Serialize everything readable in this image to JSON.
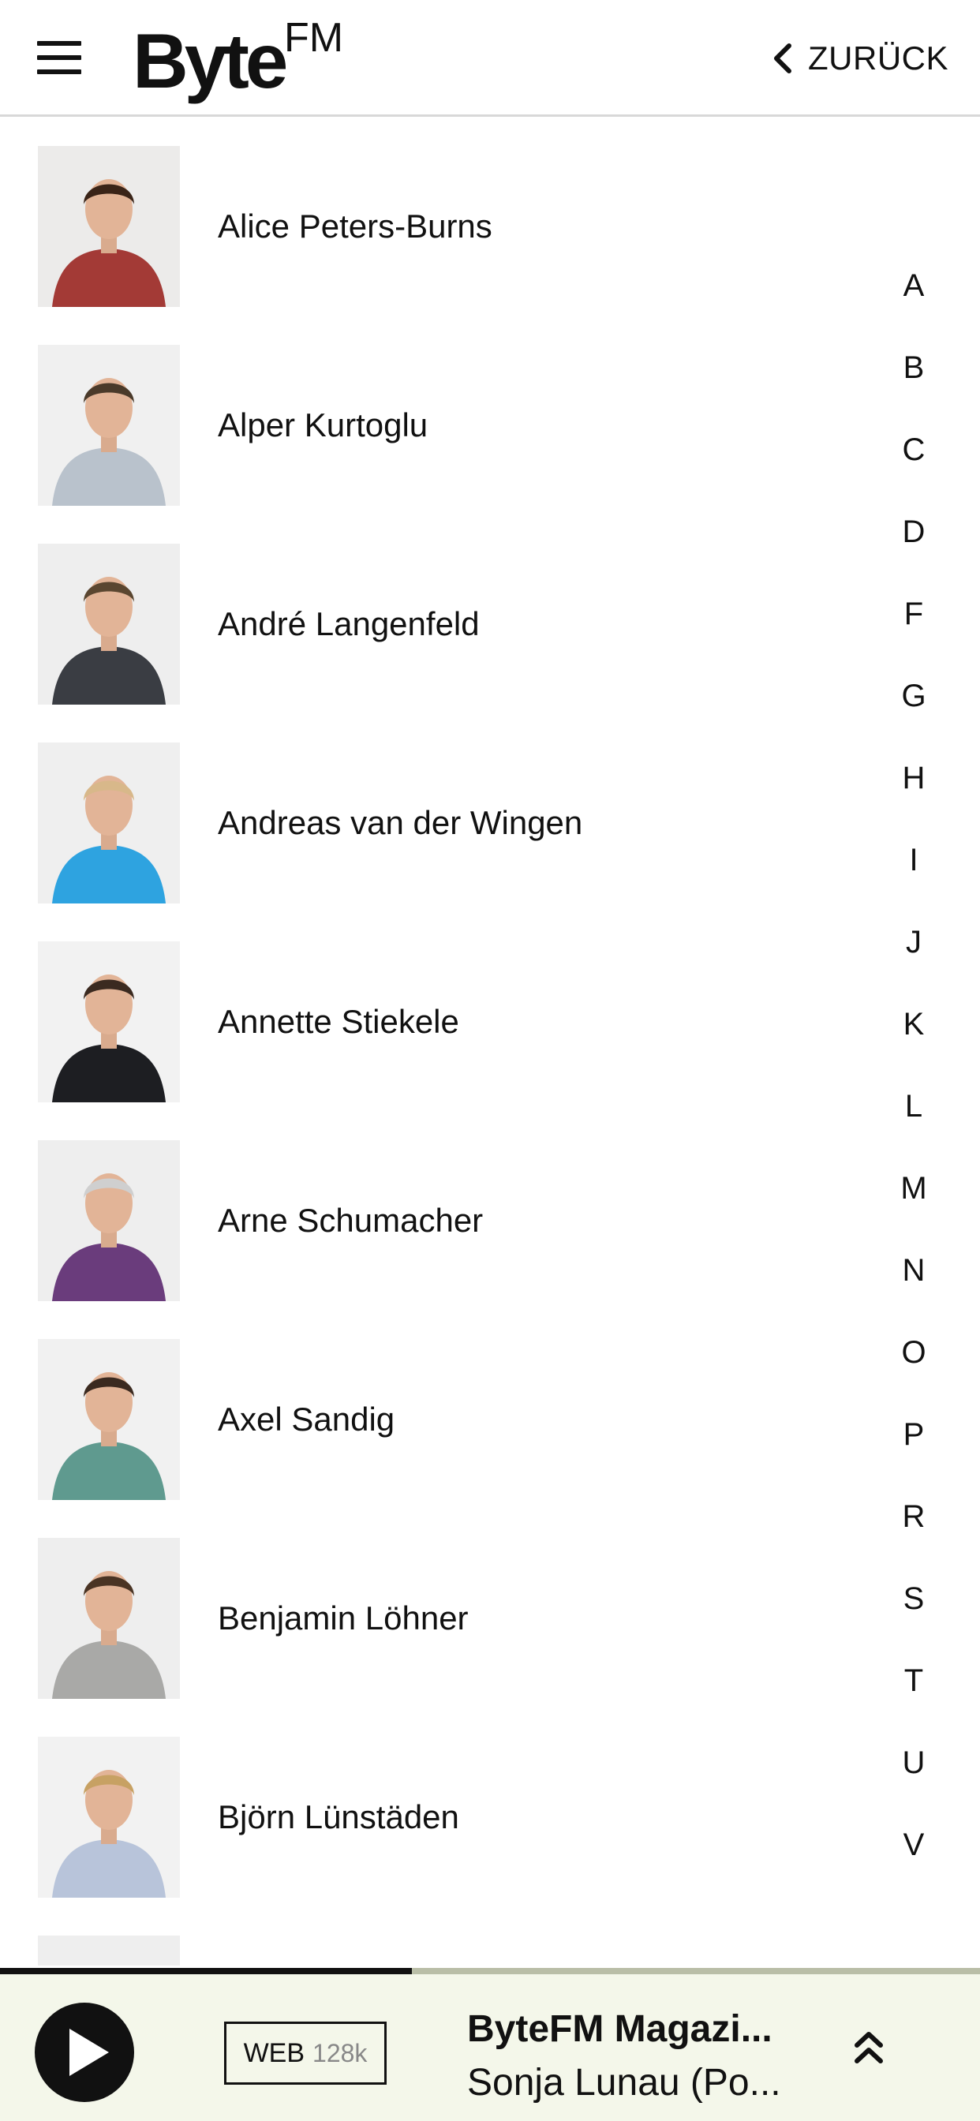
{
  "header": {
    "logo_main": "Byte",
    "logo_sup": "FM",
    "back_label": "ZURÜCK"
  },
  "people": [
    {
      "name": "Alice Peters-Burns",
      "shirt": "#a33a36",
      "hair": "#3a2418",
      "bg": "#ecebea"
    },
    {
      "name": "Alper Kurtoglu",
      "shirt": "#b9c2cc",
      "hair": "#4a3a2a",
      "bg": "#f0f0f0"
    },
    {
      "name": "André Langenfeld",
      "shirt": "#3a3d43",
      "hair": "#5a4630",
      "bg": "#eeeeee"
    },
    {
      "name": "Andreas van der Wingen",
      "shirt": "#2ea3e0",
      "hair": "#d8b88a",
      "bg": "#efefef"
    },
    {
      "name": "Annette Stiekele",
      "shirt": "#1d1e22",
      "hair": "#3b2a20",
      "bg": "#f2f2f2"
    },
    {
      "name": "Arne Schumacher",
      "shirt": "#6a3c7c",
      "hair": "#cfcfcf",
      "bg": "#eeeeee"
    },
    {
      "name": "Axel Sandig",
      "shirt": "#5f9a8f",
      "hair": "#3b2a20",
      "bg": "#f1f1f1"
    },
    {
      "name": "Benjamin Löhner",
      "shirt": "#a9a9a7",
      "hair": "#4a3424",
      "bg": "#eeeeee"
    },
    {
      "name": "Björn Lünstäden",
      "shirt": "#b8c4da",
      "hair": "#c7a163",
      "bg": "#f2f2f2"
    },
    {
      "name": "",
      "shirt": "#c0a898",
      "hair": "#c0a898",
      "bg": "#eeeeee"
    }
  ],
  "alphabet": [
    "A",
    "B",
    "C",
    "D",
    "F",
    "G",
    "H",
    "I",
    "J",
    "K",
    "L",
    "M",
    "N",
    "O",
    "P",
    "R",
    "S",
    "T",
    "U",
    "V"
  ],
  "player": {
    "stream_label": "WEB",
    "stream_rate": "128k",
    "show_title": "ByteFM Magazi...",
    "show_subtitle": "Sonja Lunau (Po...",
    "progress": 0.42
  },
  "colors": {
    "player_bg": "#f4f7ea",
    "progress_track": "#b9bea7",
    "progress_fill": "#111111"
  },
  "icons": {
    "menu": "hamburger-menu-icon",
    "back": "chevron-left-icon",
    "play": "play-icon",
    "expand": "double-chevron-up-icon"
  }
}
